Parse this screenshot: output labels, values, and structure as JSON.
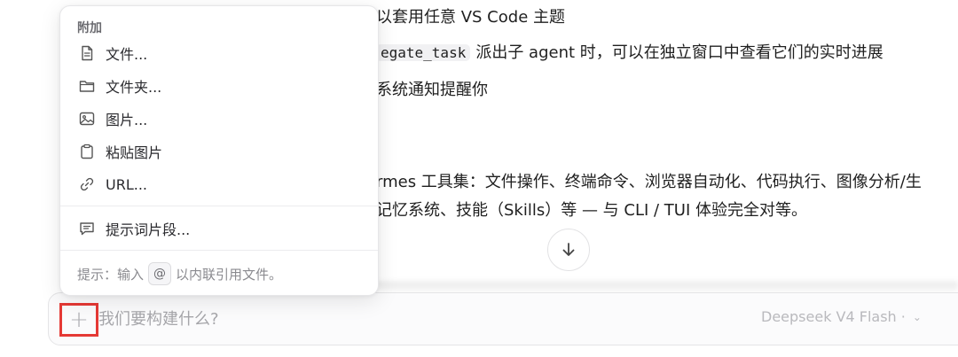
{
  "chat": {
    "line1": "以套用任意 VS Code 主题",
    "line2_code": "egate_task",
    "line2_text": "派出子 agent 时，可以在独立窗口中查看它们的实时进展",
    "line3": "系统通知提醒你",
    "line4": "rmes 工具集：文件操作、终端命令、浏览器自动化、代码执行、图像分析/生",
    "line5": "记忆系统、技能（Skills）等 — 与 CLI / TUI 体验完全对等。"
  },
  "menu": {
    "heading": "附加",
    "items": [
      {
        "label": "文件...",
        "icon": "file-icon"
      },
      {
        "label": "文件夹...",
        "icon": "folder-icon"
      },
      {
        "label": "图片...",
        "icon": "image-icon"
      },
      {
        "label": "粘贴图片",
        "icon": "clipboard-icon"
      },
      {
        "label": "URL...",
        "icon": "link-icon"
      },
      {
        "label": "提示词片段...",
        "icon": "snippet-icon"
      }
    ],
    "hint_prefix": "提示：输入",
    "hint_key": "@",
    "hint_suffix": "以内联引用文件。"
  },
  "composer": {
    "add_label": "+",
    "placeholder": "我们要构建什么?",
    "model": "Deepseek V4 Flash ·",
    "model_chevron": "⌄"
  },
  "colors": {
    "highlight_border": "#e53935",
    "menu_bg": "#ffffff",
    "text": "#1f1f1f",
    "muted": "#8a8a8f"
  }
}
